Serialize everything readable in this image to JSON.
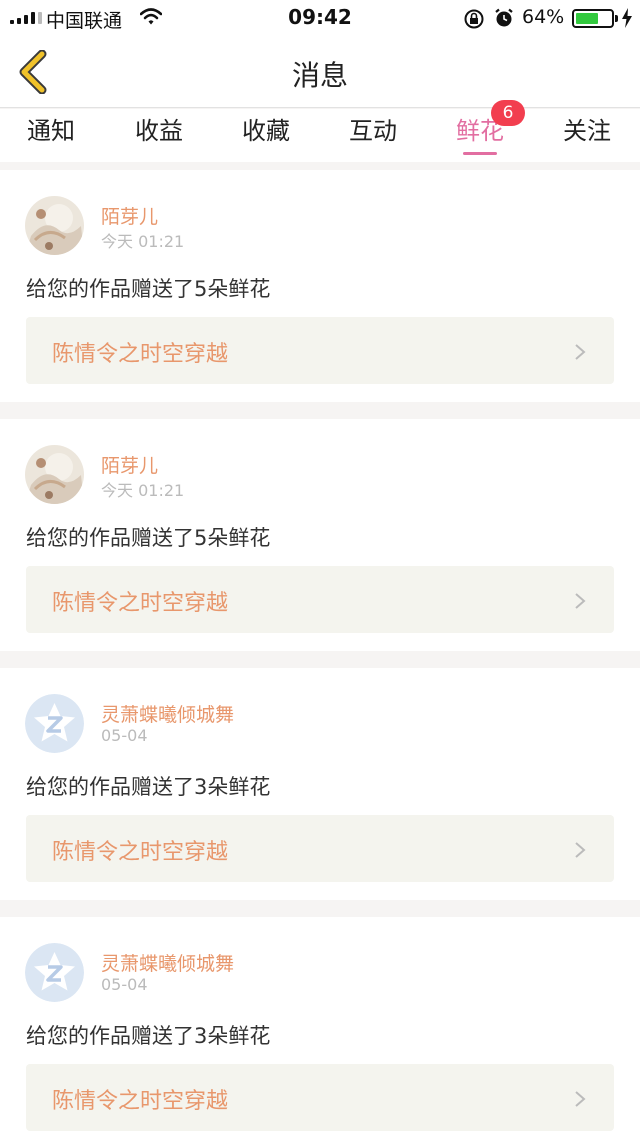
{
  "status_bar": {
    "carrier": "中国联通",
    "time": "09:42",
    "battery_percent": "64%",
    "battery_level": 0.64
  },
  "header": {
    "title": "消息"
  },
  "tabs": [
    {
      "label": "通知"
    },
    {
      "label": "收益"
    },
    {
      "label": "收藏"
    },
    {
      "label": "互动"
    },
    {
      "label": "鲜花",
      "badge": "6",
      "active": true
    },
    {
      "label": "关注"
    }
  ],
  "messages": [
    {
      "username": "陌芽儿",
      "time": "今天 01:21",
      "text": "给您的作品赠送了5朵鲜花",
      "work_title": "陈情令之时空穿越",
      "avatar": "photo-avatar"
    },
    {
      "username": "陌芽儿",
      "time": "今天 01:21",
      "text": "给您的作品赠送了5朵鲜花",
      "work_title": "陈情令之时空穿越",
      "avatar": "photo-avatar"
    },
    {
      "username": "灵萧蝶曦倾城舞",
      "time": "05-04",
      "text": "给您的作品赠送了3朵鲜花",
      "work_title": "陈情令之时空穿越",
      "avatar": "default-z-avatar"
    },
    {
      "username": "灵萧蝶曦倾城舞",
      "time": "05-04",
      "text": "给您的作品赠送了3朵鲜花",
      "work_title": "陈情令之时空穿越",
      "avatar": "default-z-avatar"
    }
  ],
  "colors": {
    "accent_pink": "#e26ea1",
    "username_orange": "#e8976c",
    "badge_red": "#f23e4f",
    "back_arrow_yellow": "#f0c22a"
  }
}
